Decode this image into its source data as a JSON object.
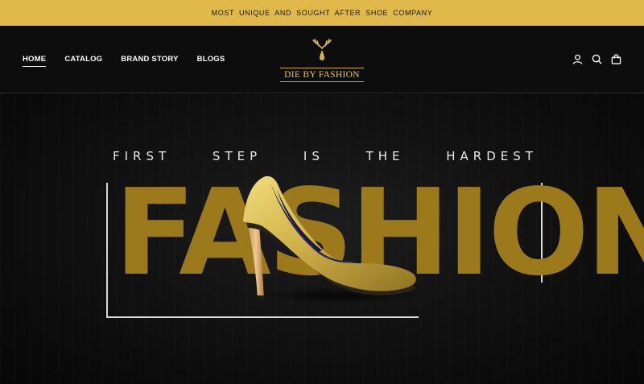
{
  "announcement": {
    "text": "MOST UNIQUE AND SOUGHT AFTER SHOE COMPANY"
  },
  "nav": {
    "items": [
      {
        "label": "HOME",
        "active": true
      },
      {
        "label": "CATALOG",
        "active": false
      },
      {
        "label": "BRAND STORY",
        "active": false
      },
      {
        "label": "BLOGS",
        "active": false
      }
    ]
  },
  "logo": {
    "text": "DIE BY FASHION",
    "icon": "antler-drop-icon"
  },
  "header_icons": [
    "account-icon",
    "search-icon",
    "cart-icon"
  ],
  "hero": {
    "tagline_words": [
      "FIRST",
      "STEP",
      "IS",
      "THE",
      "HARDEST"
    ],
    "big_word": "FASHION",
    "image": "gold-high-heel-shoe"
  },
  "colors": {
    "announcement_bg": "#e0b94a",
    "gold_text": "#9c7a1c",
    "logo_gold": "#e6c35e",
    "background": "#0b0b0b"
  }
}
